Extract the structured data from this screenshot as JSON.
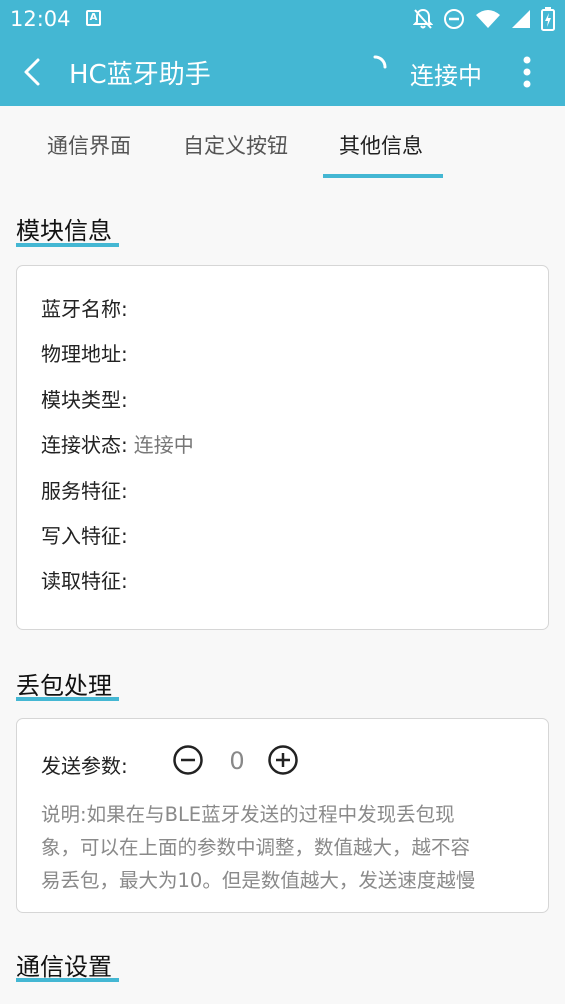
{
  "status_bar": {
    "time": "12:04",
    "app_icon_letter": "A",
    "icons": [
      "notifications-off-icon",
      "do-not-disturb-icon",
      "wifi-icon",
      "cellular-signal-icon",
      "battery-charging-icon"
    ]
  },
  "app_bar": {
    "title": "HC蓝牙助手",
    "connection_status": "连接中",
    "background_color": "#44b7d3"
  },
  "tabs": [
    {
      "label": "通信界面",
      "active": false
    },
    {
      "label": "自定义按钮",
      "active": false
    },
    {
      "label": "其他信息",
      "active": true
    }
  ],
  "module_info": {
    "section_title": "模块信息",
    "fields": [
      {
        "label": "蓝牙名称:",
        "value": ""
      },
      {
        "label": "物理地址:",
        "value": ""
      },
      {
        "label": "模块类型:",
        "value": ""
      },
      {
        "label": "连接状态:",
        "value": "连接中"
      },
      {
        "label": "服务特征:",
        "value": ""
      },
      {
        "label": "写入特征:",
        "value": ""
      },
      {
        "label": "读取特征:",
        "value": ""
      }
    ]
  },
  "packet_loss": {
    "section_title": "丢包处理",
    "param_label": "发送参数:",
    "param_value": "0",
    "note_lines": [
      "说明:如果在与BLE蓝牙发送的过程中发现丢包现",
      "象，可以在上面的参数中调整，数值越大，越不容",
      "易丢包，最大为10。但是数值越大，发送速度越慢"
    ]
  },
  "comm_settings": {
    "section_title": "通信设置"
  }
}
